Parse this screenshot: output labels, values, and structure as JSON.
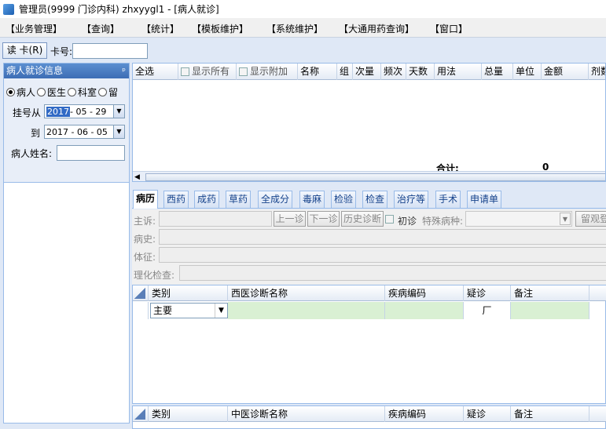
{
  "window": {
    "title": "管理员(9999 门诊内科) zhxyygl1 - [病人就诊]"
  },
  "menu": [
    "【业务管理】",
    "【查询】",
    "【统计】",
    "【模板维护】",
    "【系统维护】",
    "【大通用药查询】",
    "【窗口】"
  ],
  "cardbar": {
    "read_button": "读 卡(R)",
    "card_label": "卡号:",
    "card_value": ""
  },
  "left": {
    "panel_title": "病人就诊信息",
    "pin_icon": "pin-icon",
    "radios": [
      "病人",
      "医生",
      "科室",
      "留"
    ],
    "radio_selected": "病人",
    "from_label": "挂号从",
    "from_year": "2017",
    "from_rest": " - 05 - 29",
    "to_label": "到",
    "to_date": "2017 - 06 - 05",
    "name_label": "病人姓名:"
  },
  "rx_grid": {
    "select_all": "全选",
    "show_all": "显示所有",
    "show_extra": "显示附加",
    "columns": [
      "名称",
      "组",
      "次量",
      "频次",
      "天数",
      "用法",
      "总量",
      "单位",
      "金额",
      "剂数"
    ],
    "total_label": "合计:",
    "total_value": "0"
  },
  "tabs": [
    "病历",
    "西药",
    "成药",
    "草药",
    "全成分",
    "毒麻",
    "检验",
    "检查",
    "治疗等",
    "手术",
    "申请单"
  ],
  "tab_active": "病历",
  "emr": {
    "chief_label": "主诉:",
    "prev_button": "上一诊",
    "next_button": "下一诊",
    "history_button": "历史诊断",
    "first_visit": "初诊",
    "special_label": "特殊病种:",
    "observe_button": "留观登",
    "history_label": "病史:",
    "sign_label": "体征:",
    "exam_label": "理化检查:"
  },
  "west_diag": {
    "columns": [
      "类别",
      "西医诊断名称",
      "疾病编码",
      "疑诊",
      "备注"
    ],
    "row": {
      "category": "主要",
      "suspect": "厂"
    }
  },
  "tcm_diag": {
    "columns": [
      "类别",
      "中医诊断名称",
      "疾病编码",
      "疑诊",
      "备注"
    ]
  }
}
